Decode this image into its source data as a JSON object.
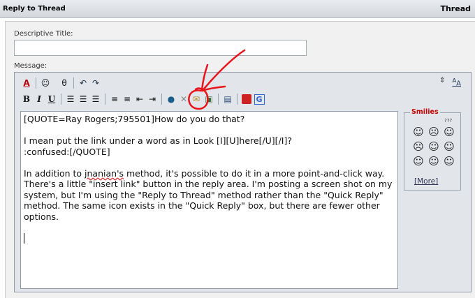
{
  "header": {
    "title": "Reply to Thread",
    "right_label": "Thread"
  },
  "form": {
    "title_label": "Descriptive Title:",
    "title_value": "",
    "message_label": "Message:"
  },
  "toolbar": {
    "row1": [
      {
        "name": "remove-format-icon",
        "glyph": "Ⓐ"
      },
      {
        "name": "smilie-icon",
        "glyph": "☺"
      },
      {
        "name": "font-icon",
        "glyph": "θ"
      },
      {
        "name": "undo-icon",
        "glyph": "↶"
      },
      {
        "name": "redo-icon",
        "glyph": "↷"
      }
    ],
    "row2_format": {
      "bold": "B",
      "italic": "I",
      "underline": "U"
    },
    "toggle_size": "⇕",
    "switch_mode": "A"
  },
  "message": {
    "lines": [
      "[QUOTE=Ray Rogers;795501]How do you do that?",
      "I mean put the link under a word as in Look [I][U]here[/U][/I]?\n:confused:[/QUOTE]",
      "In addition to jnanian's method, it's possible to do it in a more point-and-click way. There's a little \"insert link\" button in the reply area. I'm posting a screen shot on my system, but I'm using the \"Reply to Thread\" method rather than the \"Quick Reply\" method. The same icon exists in the \"Quick Reply\" box, but there are fewer other options."
    ],
    "p3_pre": "In addition to ",
    "p3_word": "jnanian's",
    "p3_post": " method, it's possible to do it in a more point-and-click way. There's a little \"insert link\" button in the reply area. I'm posting a screen shot on my system, but I'm using the \"Reply to Thread\" method rather than the \"Quick Reply\" method. The same icon exists in the \"Quick Reply\" box, but there are fewer other options."
  },
  "smilies": {
    "legend": "Smilies",
    "more_label": "[More]",
    "icons": [
      "☺",
      "☹",
      "☺",
      "☹",
      "☺",
      "☺",
      "☺",
      "☺",
      "☺"
    ],
    "extra_mark": "???"
  },
  "annotation": {
    "color": "#e8141c"
  }
}
